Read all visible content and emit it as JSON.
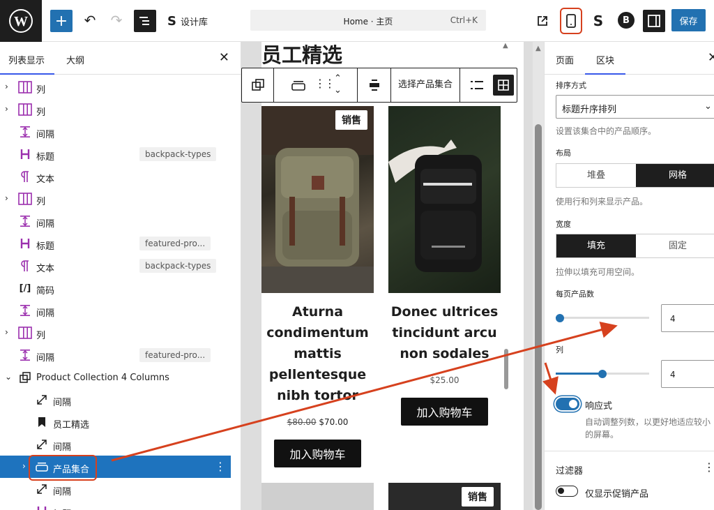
{
  "topbar": {
    "site_editor_label": "设计库",
    "command": "Home · 主页",
    "shortcut": "Ctrl+K",
    "save_label": "保存"
  },
  "left_panel": {
    "tab_list": "列表显示",
    "tab_outline": "大纲",
    "rows": [
      {
        "label": "列",
        "icon": "columns-icon",
        "anchor": ""
      },
      {
        "label": "列",
        "icon": "columns-icon",
        "anchor": ""
      },
      {
        "label": "间隔",
        "icon": "spacer-icon",
        "anchor": ""
      },
      {
        "label": "标题",
        "icon": "heading-icon",
        "anchor": "backpack-types"
      },
      {
        "label": "文本",
        "icon": "paragraph-icon",
        "anchor": ""
      },
      {
        "label": "列",
        "icon": "columns-icon",
        "anchor": ""
      },
      {
        "label": "间隔",
        "icon": "spacer-icon",
        "anchor": ""
      },
      {
        "label": "标题",
        "icon": "heading-icon",
        "anchor": "featured-pro..."
      },
      {
        "label": "文本",
        "icon": "paragraph-icon",
        "anchor": "backpack-types"
      },
      {
        "label": "简码",
        "icon": "shortcode-icon",
        "anchor": ""
      },
      {
        "label": "间隔",
        "icon": "spacer-icon",
        "anchor": ""
      },
      {
        "label": "列",
        "icon": "columns-icon",
        "anchor": ""
      },
      {
        "label": "间隔",
        "icon": "spacer-icon",
        "anchor": "featured-pro..."
      },
      {
        "label": "Product Collection 4 Columns",
        "icon": "group-icon",
        "anchor": ""
      },
      {
        "label": "间隔",
        "icon": "resize-icon",
        "anchor": ""
      },
      {
        "label": "员工精选",
        "icon": "bookmark-icon",
        "anchor": ""
      },
      {
        "label": "间隔",
        "icon": "resize-icon",
        "anchor": ""
      },
      {
        "label": "产品集合",
        "icon": "collection-icon",
        "anchor": ""
      },
      {
        "label": "间隔",
        "icon": "resize-icon",
        "anchor": ""
      },
      {
        "label": "标题",
        "icon": "heading-icon",
        "anchor": ""
      }
    ]
  },
  "canvas": {
    "heading": "员工精选",
    "toolbar_collection": "选择产品集合",
    "products": [
      {
        "title": "Aturna condimentum mattis pellentesque nibh tortor",
        "old_price": "$80.00",
        "price": "$70.00",
        "button": "加入购物车",
        "badge": "销售"
      },
      {
        "title": "Donec ultrices tincidunt arcu non sodales",
        "old_price": "",
        "price": "$25.00",
        "button": "加入购物车",
        "badge": ""
      }
    ],
    "bottom_badge": "销售"
  },
  "right_panel": {
    "tab_page": "页面",
    "tab_block": "区块",
    "sort_label": "排序方式",
    "sort_value": "标题升序排列",
    "sort_help": "设置该集合中的产品顺序。",
    "layout_label": "布局",
    "layout_stack": "堆叠",
    "layout_grid": "网格",
    "layout_help": "使用行和列来显示产品。",
    "width_label": "宽度",
    "width_fill": "填充",
    "width_fixed": "固定",
    "width_help": "拉伸以填充可用空间。",
    "per_page_label": "每页产品数",
    "per_page_value": "4",
    "per_page_fraction": 0.0,
    "columns_label": "列",
    "columns_value": "4",
    "columns_fraction": 0.5,
    "responsive_label": "响应式",
    "responsive_help": "自动调整列数，以更好地适应较小的屏幕。",
    "filters_label": "过滤器",
    "sale_only_label": "仅显示促销产品"
  },
  "colors": {
    "accent": "#3858e9",
    "selected": "#1e73be",
    "annotation": "#d6411e",
    "icon_purple": "#9b2fae"
  }
}
